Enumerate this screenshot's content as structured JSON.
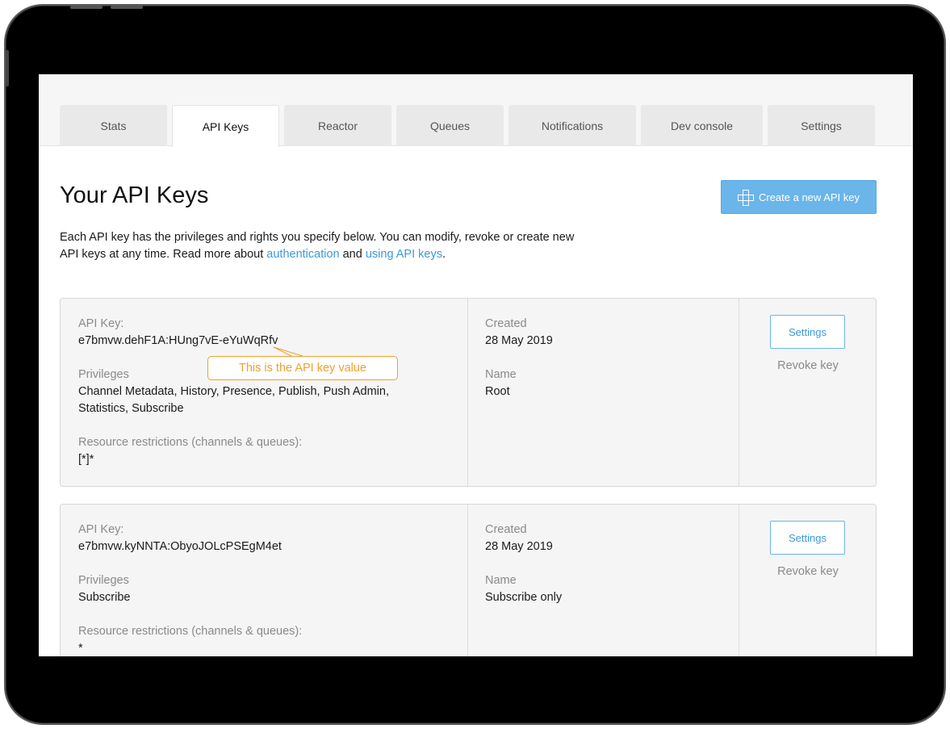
{
  "tabs": [
    {
      "label": "Stats",
      "active": false
    },
    {
      "label": "API Keys",
      "active": true
    },
    {
      "label": "Reactor",
      "active": false
    },
    {
      "label": "Queues",
      "active": false
    },
    {
      "label": "Notifications",
      "active": false
    },
    {
      "label": "Dev console",
      "active": false
    },
    {
      "label": "Settings",
      "active": false
    }
  ],
  "page": {
    "title": "Your API Keys",
    "create_button_label": "Create a new API key",
    "create_button_icon": "plus-icon",
    "intro_part1": "Each API key has the privileges and rights you specify below. You can modify, revoke or create new API keys at any time. Read more about ",
    "intro_link1": "authentication",
    "intro_part2": " and ",
    "intro_link2": "using API keys",
    "intro_part3": "."
  },
  "callout": {
    "text": "This is the API key value"
  },
  "keys": [
    {
      "api_key_label": "API Key:",
      "api_key": "e7bmvw.dehF1A:HUng7vE-eYuWqRfv",
      "privileges_label": "Privileges",
      "privileges": "Channel Metadata, History, Presence, Publish, Push Admin, Statistics, Subscribe",
      "restrictions_label": "Resource restrictions (channels & queues):",
      "restrictions": "[*]*",
      "created_label": "Created",
      "created": "28 May 2019",
      "name_label": "Name",
      "name": "Root",
      "settings_label": "Settings",
      "revoke_label": "Revoke key"
    },
    {
      "api_key_label": "API Key:",
      "api_key": "e7bmvw.kyNNTA:ObyoJOLcPSEgM4et",
      "privileges_label": "Privileges",
      "privileges": "Subscribe",
      "restrictions_label": "Resource restrictions (channels & queues):",
      "restrictions": "*",
      "created_label": "Created",
      "created": "28 May 2019",
      "name_label": "Name",
      "name": "Subscribe only",
      "settings_label": "Settings",
      "revoke_label": "Revoke key"
    }
  ],
  "colors": {
    "accent": "#6ab5e9",
    "link": "#3a9ad9",
    "callout": "#f0a030"
  }
}
